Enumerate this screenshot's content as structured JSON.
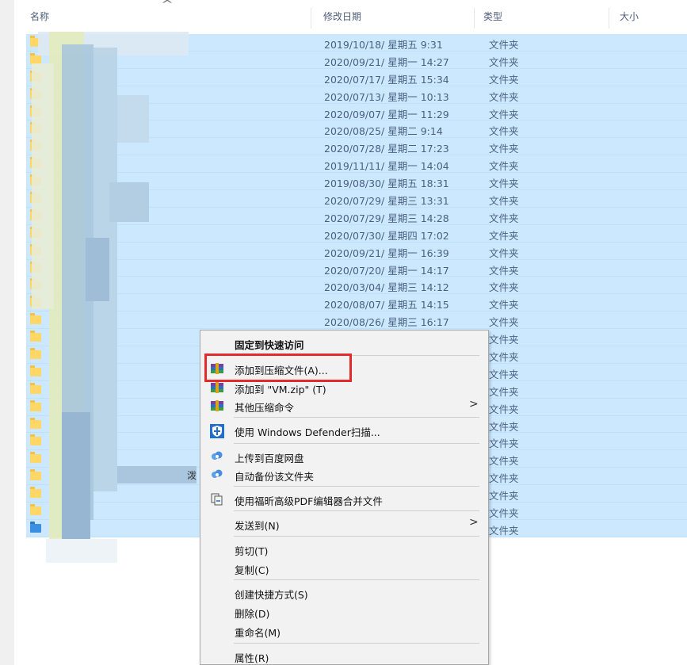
{
  "header": {
    "col_name": "名称",
    "col_date": "修改日期",
    "col_type": "类型",
    "col_size": "大小",
    "sort_arrow": "^"
  },
  "rows": [
    {
      "date": "2019/10/18/ 星期五 9:31",
      "type": "文件夹"
    },
    {
      "date": "2020/09/21/ 星期一 14:27",
      "type": "文件夹"
    },
    {
      "date": "2020/07/17/ 星期五 15:34",
      "type": "文件夹"
    },
    {
      "date": "2020/07/13/ 星期一 10:13",
      "type": "文件夹"
    },
    {
      "date": "2020/09/07/ 星期一 11:29",
      "type": "文件夹"
    },
    {
      "date": "2020/08/25/ 星期二 9:14",
      "type": "文件夹"
    },
    {
      "date": "2020/07/28/ 星期二 17:23",
      "type": "文件夹"
    },
    {
      "date": "2019/11/11/ 星期一 14:04",
      "type": "文件夹"
    },
    {
      "date": "2019/08/30/ 星期五 18:31",
      "type": "文件夹"
    },
    {
      "date": "2020/07/29/ 星期三 13:31",
      "type": "文件夹"
    },
    {
      "date": "2020/07/29/ 星期三 14:28",
      "type": "文件夹"
    },
    {
      "date": "2020/07/30/ 星期四 17:02",
      "type": "文件夹"
    },
    {
      "date": "2020/09/21/ 星期一 16:39",
      "type": "文件夹"
    },
    {
      "date": "2020/07/20/ 星期一 14:17",
      "type": "文件夹"
    },
    {
      "date": "2020/03/04/ 星期三 14:12",
      "type": "文件夹"
    },
    {
      "date": "2020/08/07/ 星期五 14:15",
      "type": "文件夹"
    },
    {
      "date": "2020/08/26/ 星期三 16:17",
      "type": "文件夹"
    },
    {
      "date": "",
      "type": "文件夹"
    },
    {
      "date": "",
      "type": "文件夹"
    },
    {
      "date": "",
      "type": "文件夹"
    },
    {
      "date": "",
      "type": "文件夹"
    },
    {
      "date": "",
      "type": "文件夹"
    },
    {
      "date": "",
      "type": "文件夹"
    },
    {
      "date": "",
      "type": "文件夹"
    },
    {
      "date": "",
      "type": "文件夹"
    },
    {
      "date": "",
      "type": "文件夹"
    },
    {
      "date": "",
      "type": "文件夹"
    },
    {
      "date": "",
      "type": "文件夹"
    },
    {
      "date": "",
      "type": "文件夹"
    }
  ],
  "partial_name_glyph": "泼",
  "context_menu": {
    "pin": "固定到快速访问",
    "add_archive": "添加到压缩文件(A)...",
    "add_vmzip": "添加到 \"VM.zip\" (T)",
    "other_compress": "其他压缩命令",
    "defender": "使用 Windows Defender扫描...",
    "upload_baidu": "上传到百度网盘",
    "auto_backup": "自动备份该文件夹",
    "foxit_merge": "使用福昕高级PDF编辑器合并文件",
    "send_to": "发送到(N)",
    "cut": "剪切(T)",
    "copy": "复制(C)",
    "create_shortcut": "创建快捷方式(S)",
    "delete": "删除(D)",
    "rename": "重命名(M)",
    "properties": "属性(R)",
    "submenu_arrow": ">"
  },
  "colors": {
    "selection": "#cce8ff",
    "highlight_box": "#e32b2b",
    "folder": "#ffd767"
  }
}
